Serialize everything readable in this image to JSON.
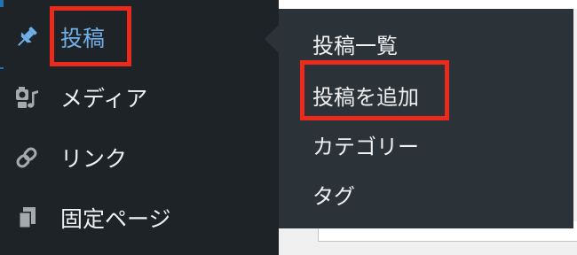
{
  "sidebar": {
    "items": [
      {
        "label": "投稿",
        "icon": "pin-icon"
      },
      {
        "label": "メディア",
        "icon": "media-icon"
      },
      {
        "label": "リンク",
        "icon": "link-icon"
      },
      {
        "label": "固定ページ",
        "icon": "pages-icon"
      }
    ]
  },
  "submenu": {
    "items": [
      "投稿一覧",
      "投稿を追加",
      "カテゴリー",
      "タグ"
    ]
  },
  "colors": {
    "sidebar_bg": "#1d2327",
    "submenu_bg": "#2c3338",
    "active_text": "#72aee6",
    "highlight_border": "#ea2a1c"
  }
}
